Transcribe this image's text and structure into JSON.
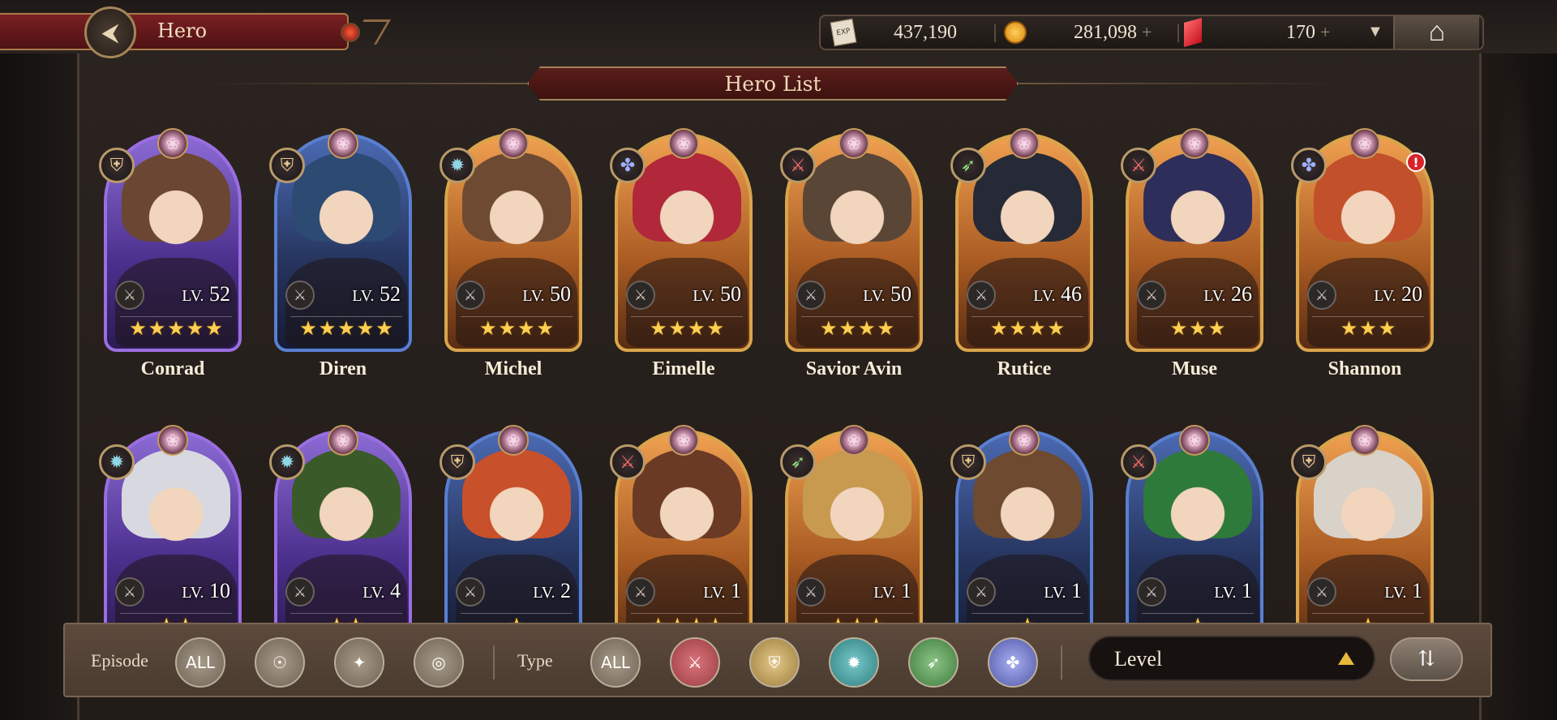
{
  "header": {
    "back_title": "Hero",
    "resources": [
      {
        "icon": "exp-ticket-icon",
        "value": "437,190",
        "plus": ""
      },
      {
        "icon": "gold-coin-icon",
        "value": "281,098",
        "plus": "+"
      },
      {
        "icon": "crystal-icon",
        "value": "170",
        "plus": "+"
      }
    ],
    "exp_icon_text": "EXP"
  },
  "section_title": "Hero List",
  "heroes": [
    {
      "name": "Conrad",
      "level": "52",
      "stars": 5,
      "frame": "purple",
      "class_icon": "shield-class-icon"
    },
    {
      "name": "Diren",
      "level": "52",
      "stars": 5,
      "frame": "blue",
      "class_icon": "shield-class-icon"
    },
    {
      "name": "Michel",
      "level": "50",
      "stars": 4,
      "frame": "gold",
      "class_icon": "magic-class-icon"
    },
    {
      "name": "Eimelle",
      "level": "50",
      "stars": 4,
      "frame": "gold",
      "class_icon": "cross-class-icon"
    },
    {
      "name": "Savior Avin",
      "level": "50",
      "stars": 4,
      "frame": "gold",
      "class_icon": "sword-class-icon"
    },
    {
      "name": "Rutice",
      "level": "46",
      "stars": 4,
      "frame": "gold",
      "class_icon": "bow-class-icon"
    },
    {
      "name": "Muse",
      "level": "26",
      "stars": 3,
      "frame": "gold",
      "class_icon": "sword-class-icon"
    },
    {
      "name": "Shannon",
      "level": "20",
      "stars": 3,
      "frame": "gold",
      "class_icon": "cross-class-icon",
      "alert": "!"
    },
    {
      "name": "",
      "level": "10",
      "stars": 2,
      "frame": "purple",
      "class_icon": "magic-class-icon"
    },
    {
      "name": "",
      "level": "4",
      "stars": 2,
      "frame": "purple",
      "class_icon": "magic-class-icon"
    },
    {
      "name": "",
      "level": "2",
      "stars": 1,
      "frame": "blue",
      "class_icon": "shield-class-icon"
    },
    {
      "name": "",
      "level": "1",
      "stars": 4,
      "frame": "gold",
      "class_icon": "sword-class-icon"
    },
    {
      "name": "",
      "level": "1",
      "stars": 3,
      "frame": "gold",
      "class_icon": "bow-class-icon"
    },
    {
      "name": "",
      "level": "1",
      "stars": 1,
      "frame": "blue",
      "class_icon": "shield-class-icon"
    },
    {
      "name": "",
      "level": "1",
      "stars": 1,
      "frame": "blue",
      "class_icon": "sword-class-icon"
    },
    {
      "name": "",
      "level": "1",
      "stars": 1,
      "frame": "gold",
      "class_icon": "shield-class-icon"
    }
  ],
  "lv_prefix": "LV.",
  "filters": {
    "episode_label": "Episode",
    "type_label": "Type",
    "all_label": "ALL",
    "episode_icons": [
      "episode-1-icon",
      "episode-2-icon",
      "episode-3-icon"
    ],
    "type_icons": [
      "sword-type-icon",
      "shield-type-icon",
      "magic-type-icon",
      "bow-type-icon",
      "cross-type-icon"
    ],
    "type_colors": [
      "#c0545a",
      "#c8a860",
      "#4aa6a8",
      "#5a9a58",
      "#7a82d0"
    ],
    "sort_value": "Level"
  }
}
